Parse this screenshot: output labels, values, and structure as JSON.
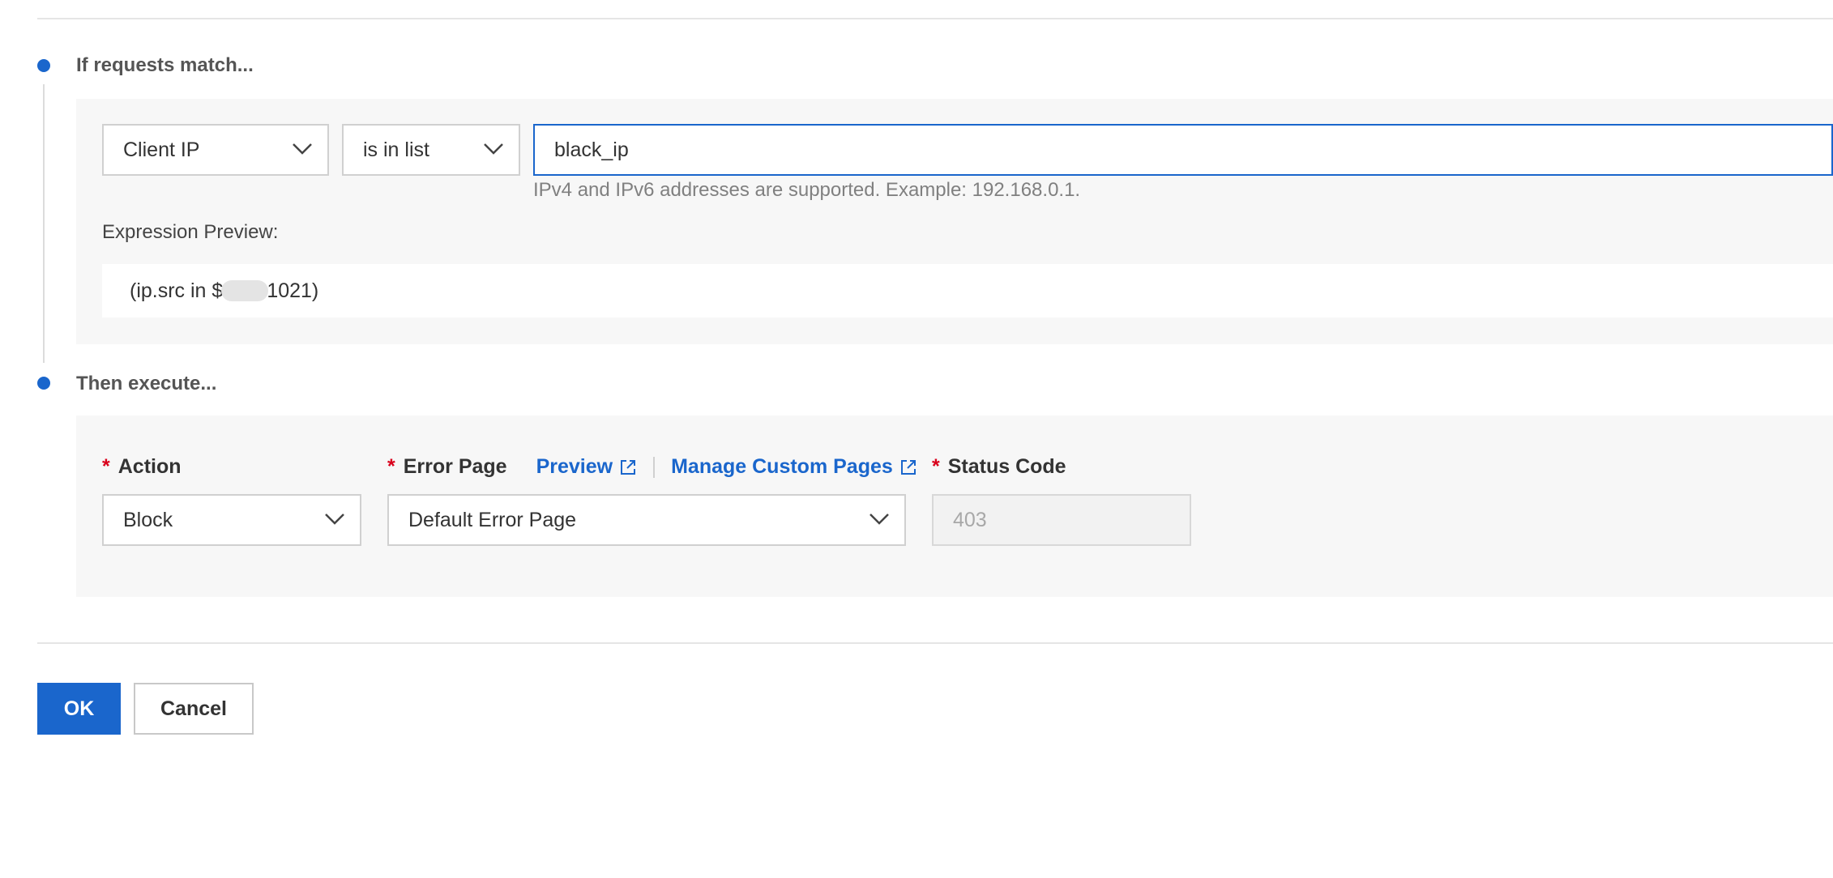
{
  "match": {
    "title": "If requests match...",
    "field_select": "Client IP",
    "operator_select": "is in list",
    "value_input": "black_ip",
    "help_text": "IPv4 and IPv6 addresses are supported. Example: 192.168.0.1.",
    "preview_label": "Expression Preview:",
    "preview_prefix": "(ip.src in $",
    "preview_suffix": "1021)"
  },
  "execute": {
    "title": "Then execute...",
    "required_mark": "*",
    "action_label": "Action",
    "action_select": "Block",
    "error_page_label": "Error Page",
    "preview_link": "Preview",
    "manage_link": "Manage Custom Pages",
    "error_page_select": "Default Error Page",
    "status_code_label": "Status Code",
    "status_code_value": "403"
  },
  "footer": {
    "ok_label": "OK",
    "cancel_label": "Cancel"
  },
  "colors": {
    "accent": "#1a66cc",
    "required": "#d9001b",
    "panel_bg": "#f7f7f7"
  },
  "icons": {
    "chevron": "chevron-down-icon",
    "external": "external-link-icon",
    "step": "step-dot-icon"
  }
}
